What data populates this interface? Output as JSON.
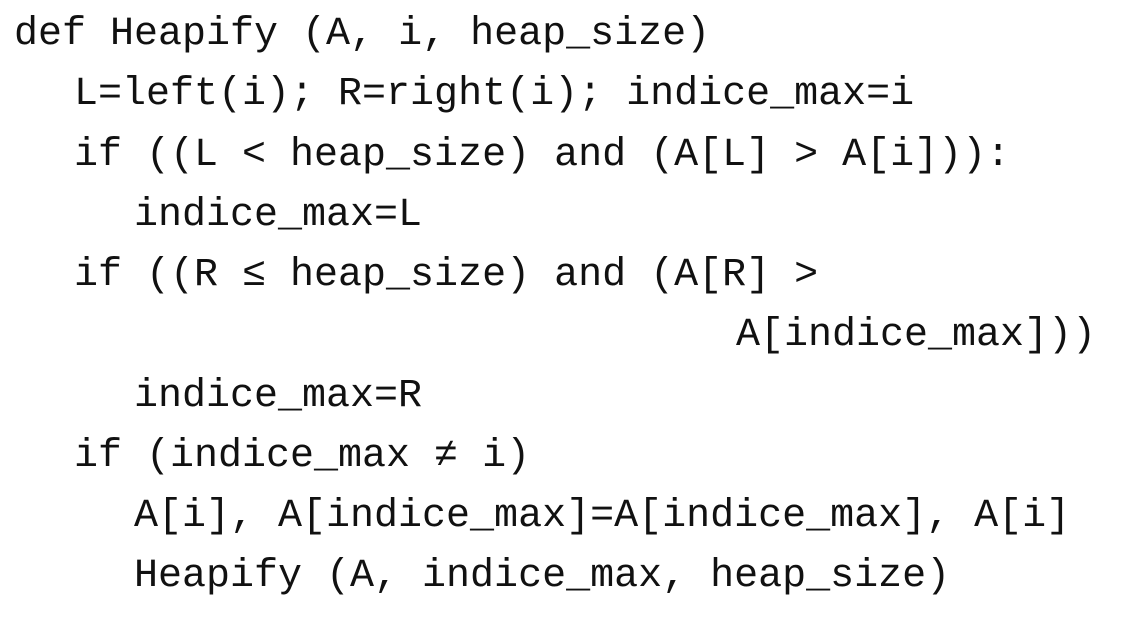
{
  "code": {
    "lines": [
      "def Heapify (A, i, heap_size)",
      "L=left(i); R=right(i); indice_max=i",
      "if ((L < heap_size) and (A[L] > A[i])):",
      "indice_max=L",
      "if ((R ≤ heap_size) and (A[R] >",
      "A[indice_max]))",
      "indice_max=R",
      "if (indice_max ≠ i)",
      "A[i], A[indice_max]=A[indice_max], A[i]",
      "Heapify (A, indice_max, heap_size)"
    ]
  }
}
